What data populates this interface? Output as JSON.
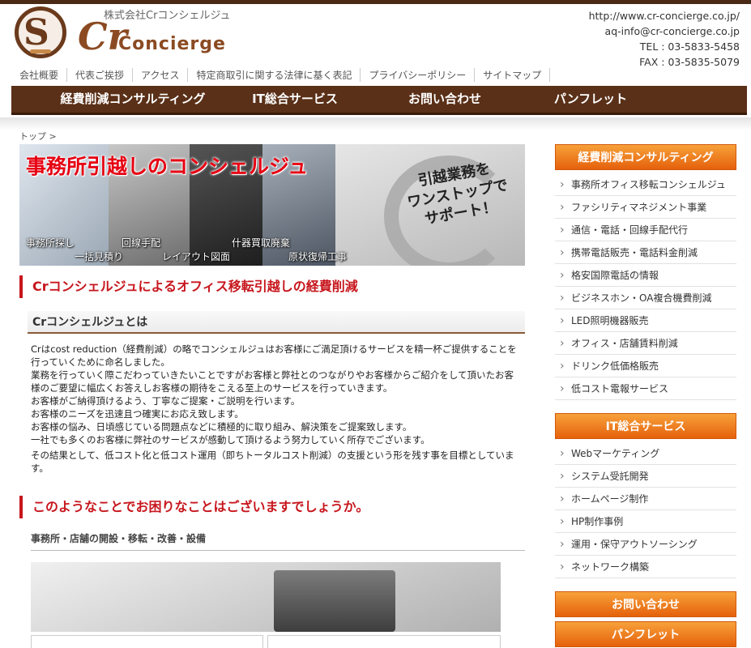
{
  "header": {
    "company": "株式会社Crコンシェルジュ",
    "logo_mark": "S",
    "logo_cr": "Cr",
    "logo_word": "Concierge",
    "url": "http://www.cr-concierge.co.jp/",
    "email": "aq-info@cr-concierge.co.jp",
    "tel": "TEL : 03-5833-5458",
    "fax": "FAX : 03-5835-5079"
  },
  "util_nav": [
    "会社概要",
    "代表ご挨拶",
    "アクセス",
    "特定商取引に関する法律に基く表記",
    "プライバシーポリシー",
    "サイトマップ"
  ],
  "main_nav": [
    "経費削減コンサルティング",
    "IT総合サービス",
    "お問い合わせ",
    "パンフレット"
  ],
  "breadcrumb": "トップ >",
  "hero": {
    "title": "事務所引越しのコンシェルジュ",
    "circle_line1": "引越業務を",
    "circle_line2": "ワンストップで",
    "circle_line3": "サポート！",
    "captions": [
      "事務所探し",
      "一括見積り",
      "回線手配",
      "レイアウト図面",
      "什器買取廃棄",
      "原状復帰工事"
    ]
  },
  "section1": {
    "heading": "Crコンシェルジュによるオフィス移転引越しの経費削減",
    "subheading": "Crコンシェルジュとは",
    "paragraphs": [
      "Crはcost reduction（経費削減）の略でコンシェルジュはお客様にご満足頂けるサービスを精一杯ご提供することを行っていくために命名しました。",
      "業務を行っていく際こだわっていきたいことですがお客様と弊社とのつながりやお客様からご紹介をして頂いたお客様のご要望に幅広くお答えしお客様の期待をこえる至上のサービスを行っていきます。",
      "お客様がご納得頂けるよう、丁寧なご提案・ご説明を行います。",
      "お客様のニーズを迅速且つ確実にお応え致します。",
      "お客様の悩み、日頃感じている問題点などに積極的に取り組み、解決策をご提案致します。",
      "一社でも多くのお客様に弊社のサービスが感動して頂けるよう努力していく所存でございます。",
      "その結果として、低コスト化と低コスト運用（即ちトータルコスト削減）の支援という形を残す事を目標としています。"
    ]
  },
  "section2": {
    "heading": "このようなことでお困りなことはございますでしょうか。",
    "subheading": "事務所・店舗の開設・移転・改善・設備"
  },
  "sidebar": {
    "cost_head": "経費削減コンサルティング",
    "cost_items": [
      "事務所オフィス移転コンシェルジュ",
      "ファシリティマネジメント事業",
      "通信・電話・回線手配代行",
      "携帯電話販売・電話料金削減",
      "格安国際電話の情報",
      "ビジネスホン・OA複合機費削減",
      "LED照明機器販売",
      "オフィス・店舗賃料削減",
      "ドリンク低価格販売",
      "低コスト電報サービス"
    ],
    "it_head": "IT総合サービス",
    "it_items": [
      "Webマーケティング",
      "システム受託開発",
      "ホームページ制作",
      "HP制作事例",
      "運用・保守アウトソーシング",
      "ネットワーク構築"
    ],
    "contact_btn": "お問い合わせ",
    "pamphlet_btn": "パンフレット"
  }
}
